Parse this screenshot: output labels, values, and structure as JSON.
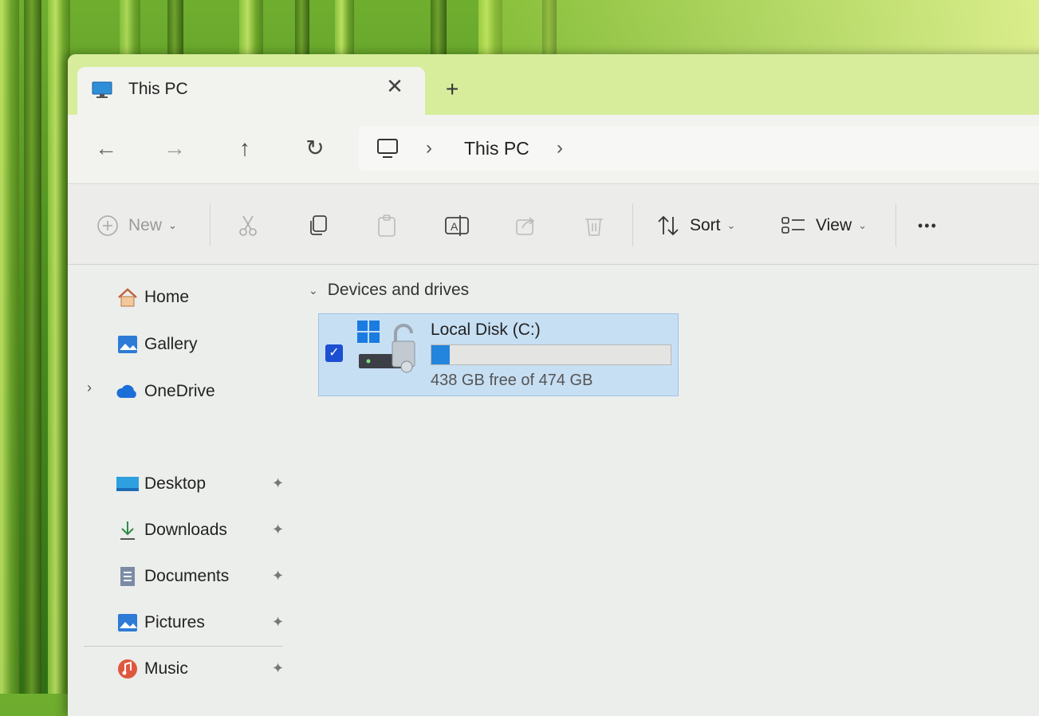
{
  "tab": {
    "title": "This PC",
    "close_glyph": "✕",
    "new_tab_glyph": "+"
  },
  "nav": {
    "back": "←",
    "forward": "→",
    "up": "↑",
    "refresh": "↻",
    "breadcrumb": "This PC",
    "sep": "›"
  },
  "toolbar": {
    "new_label": "New",
    "sort_label": "Sort",
    "view_label": "View",
    "more_glyph": "•••"
  },
  "sidebar": {
    "top": [
      {
        "label": "Home",
        "icon": "home-icon"
      },
      {
        "label": "Gallery",
        "icon": "gallery-icon"
      },
      {
        "label": "OneDrive",
        "icon": "onedrive-icon"
      }
    ],
    "pinned": [
      {
        "label": "Desktop",
        "icon": "desktop-icon"
      },
      {
        "label": "Downloads",
        "icon": "downloads-icon"
      },
      {
        "label": "Documents",
        "icon": "documents-icon"
      },
      {
        "label": "Pictures",
        "icon": "pictures-icon"
      },
      {
        "label": "Music",
        "icon": "music-icon"
      }
    ],
    "pin_glyph": "📌"
  },
  "content": {
    "group_title": "Devices and drives",
    "drives": [
      {
        "name": "Local Disk (C:)",
        "free_text": "438 GB free of 474 GB",
        "used_fraction": 0.076,
        "selected": true
      }
    ]
  },
  "colors": {
    "accent": "#1c4fd2",
    "bar_fill": "#2385dd",
    "selection": "#c7dff3",
    "titlebar": "#d7ed9c"
  }
}
